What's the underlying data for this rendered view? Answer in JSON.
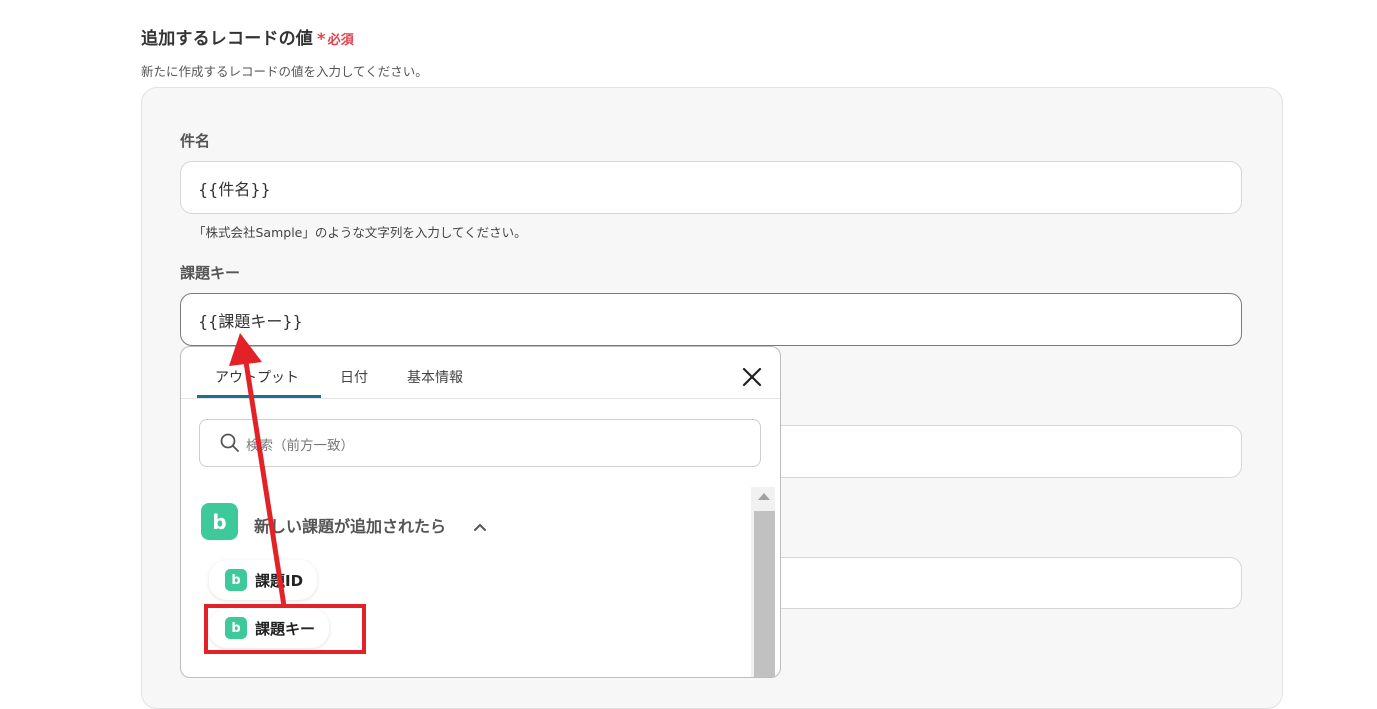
{
  "section": {
    "title": "追加するレコードの値",
    "required_star": "*",
    "required_label": "必須",
    "description": "新たに作成するレコードの値を入力してください。"
  },
  "fields": {
    "subject": {
      "label": "件名",
      "value": "{{件名}}",
      "hint": "「株式会社Sample」のような文字列を入力してください。"
    },
    "issue_key": {
      "label": "課題キー",
      "value": "{{課題キー}}"
    },
    "field3": {
      "value": ""
    },
    "field4": {
      "value": ""
    }
  },
  "popup": {
    "tabs": [
      {
        "label": "アウトプット",
        "active": true
      },
      {
        "label": "日付",
        "active": false
      },
      {
        "label": "基本情報",
        "active": false
      }
    ],
    "search_placeholder": "検索（前方一致）",
    "group": {
      "icon": "backlog-app-icon",
      "icon_letter": "b",
      "label": "新しい課題が追加されたら",
      "expanded": true
    },
    "items": [
      {
        "label": "課題ID",
        "icon_letter": "b"
      },
      {
        "label": "課題キー",
        "icon_letter": "b",
        "highlighted": true
      }
    ]
  },
  "annotation": {
    "highlight_color": "#e32227",
    "arrow_color": "#e32227"
  },
  "colors": {
    "required": "#e0424f",
    "tab_active_underline": "#1f6f8b",
    "app_icon": "#3ec99b"
  }
}
